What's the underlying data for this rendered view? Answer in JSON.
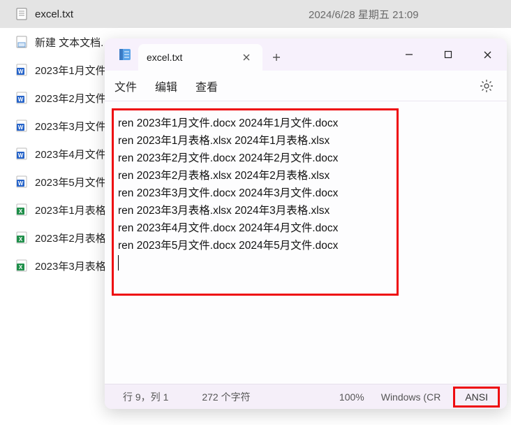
{
  "explorer": {
    "rows": [
      {
        "name": "excel.txt",
        "date": "2024/6/28 星期五 21:09",
        "icon": "txt",
        "selected": true
      },
      {
        "name": "新建 文本文档.",
        "date": "",
        "icon": "new",
        "selected": false
      },
      {
        "name": "2023年1月文件",
        "date": "",
        "icon": "word",
        "selected": false
      },
      {
        "name": "2023年2月文件",
        "date": "",
        "icon": "word",
        "selected": false
      },
      {
        "name": "2023年3月文件",
        "date": "",
        "icon": "word",
        "selected": false
      },
      {
        "name": "2023年4月文件",
        "date": "",
        "icon": "word",
        "selected": false
      },
      {
        "name": "2023年5月文件",
        "date": "",
        "icon": "word",
        "selected": false
      },
      {
        "name": "2023年1月表格",
        "date": "",
        "icon": "excel",
        "selected": false
      },
      {
        "name": "2023年2月表格",
        "date": "",
        "icon": "excel",
        "selected": false
      },
      {
        "name": "2023年3月表格",
        "date": "",
        "icon": "excel",
        "selected": false
      }
    ]
  },
  "notepad": {
    "tab_title": "excel.txt",
    "menu": {
      "file": "文件",
      "edit": "编辑",
      "view": "查看"
    },
    "lines": [
      "ren 2023年1月文件.docx 2024年1月文件.docx",
      "ren 2023年1月表格.xlsx 2024年1月表格.xlsx",
      "ren 2023年2月文件.docx 2024年2月文件.docx",
      "ren 2023年2月表格.xlsx 2024年2月表格.xlsx",
      "ren 2023年3月文件.docx 2024年3月文件.docx",
      "ren 2023年3月表格.xlsx 2024年3月表格.xlsx",
      "ren 2023年4月文件.docx 2024年4月文件.docx",
      "ren 2023年5月文件.docx 2024年5月文件.docx"
    ],
    "status": {
      "pos": "行 9，列 1",
      "chars": "272 个字符",
      "zoom": "100%",
      "eol": "Windows (CR",
      "encoding": "ANSI"
    }
  }
}
